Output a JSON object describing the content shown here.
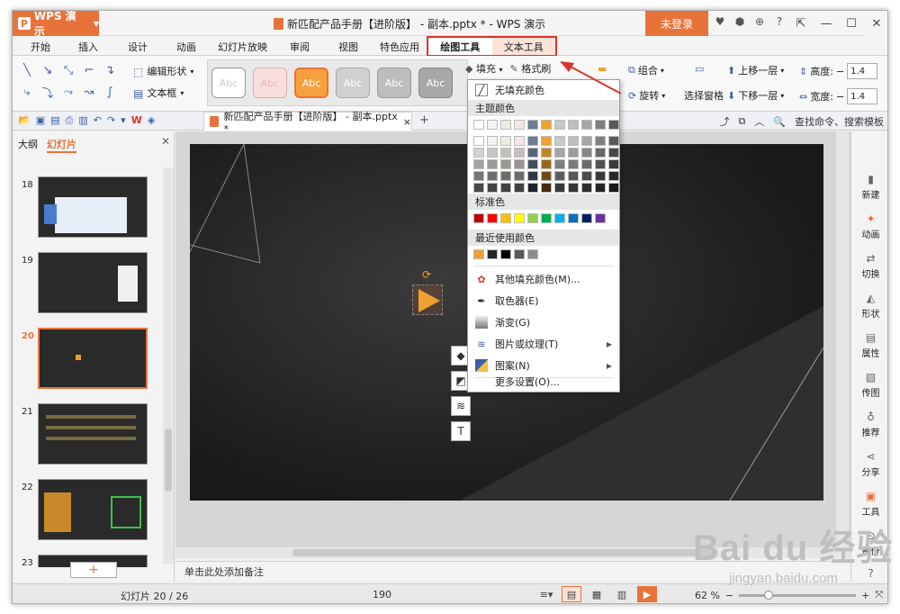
{
  "app": {
    "name": "WPS 演示",
    "logo_letter": "P",
    "title": "新匹配产品手册【进阶版】 - 副本.pptx * - WPS 演示",
    "login_label": "未登录"
  },
  "menu": {
    "tabs": [
      "开始",
      "插入",
      "设计",
      "动画",
      "幻灯片放映",
      "审阅",
      "视图",
      "特色应用"
    ],
    "tool_tabs": [
      "绘图工具",
      "文本工具"
    ]
  },
  "ribbon": {
    "edit_shape": "编辑形状",
    "text_box": "文本框",
    "style_samples": [
      "Abc",
      "Abc",
      "Abc",
      "Abc",
      "Abc",
      "Abc"
    ],
    "fill": "填充",
    "format_painter": "格式刷",
    "group": "组合",
    "rotate": "旋转",
    "selection_pane": "选择窗格",
    "bring_forward": "上移一层",
    "send_backward": "下移一层",
    "height_label": "高度:",
    "width_label": "宽度:",
    "height_value": "1.4",
    "width_value": "1.4"
  },
  "doc_tab": {
    "title": "新匹配产品手册【进阶版】 - 副本.pptx *",
    "close": "×",
    "add": "+"
  },
  "search": {
    "label": "查找命令、搜索模板"
  },
  "left_pane": {
    "tabs": [
      "大纲",
      "幻灯片"
    ],
    "slides": [
      "18",
      "19",
      "20",
      "21",
      "22",
      "23"
    ],
    "current": "20",
    "add_label": "+"
  },
  "fill_menu": {
    "no_fill": "无填充颜色",
    "theme_colors": "主题颜色",
    "standard_colors": "标准色",
    "recent_colors": "最近使用颜色",
    "more_fill": "其他填充颜色(M)...",
    "eyedropper": "取色器(E)",
    "gradient": "渐变(G)",
    "picture_texture": "图片或纹理(T)",
    "pattern": "图案(N)",
    "more_settings": "更多设置(O)...",
    "theme_top": [
      "#ffffff",
      "#f2f2f2",
      "#eeece1",
      "#f5e6e6",
      "#6b7c93",
      "#f0a030",
      "#c8c8c8",
      "#bfbfbf",
      "#a6a6a6",
      "#7f7f7f",
      "#595959"
    ],
    "standard": [
      "#c00000",
      "#ff0000",
      "#ffc000",
      "#ffff00",
      "#92d050",
      "#00b050",
      "#00b0f0",
      "#0070c0",
      "#002060",
      "#7030a0"
    ],
    "recent": [
      "#f0a030",
      "#262626",
      "#000000",
      "#595959",
      "#8c8c8c"
    ]
  },
  "right_bar": {
    "items": [
      "新建",
      "动画",
      "切换",
      "形状",
      "属性",
      "传图",
      "推荐",
      "分享",
      "工具",
      "备份",
      "帮助"
    ]
  },
  "notes": {
    "placeholder": "单击此处添加备注"
  },
  "status": {
    "slide_count": "幻灯片 20 / 26",
    "number": "190",
    "zoom": "62 %"
  },
  "watermark": {
    "brand": "Bai du 经验",
    "url": "jingyan.baidu.com"
  }
}
